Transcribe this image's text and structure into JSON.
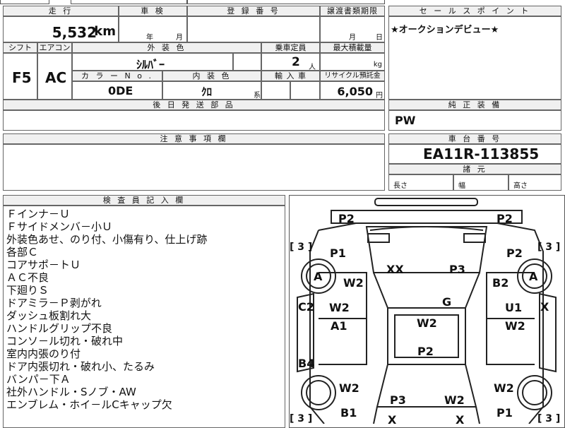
{
  "sheet": {
    "mileage": {
      "header": "走 行",
      "value": "5,532",
      "unit": "km"
    },
    "inspection": {
      "header": "車 検",
      "year": "年",
      "month": "月"
    },
    "registration": {
      "header": "登 録 番 号",
      "value": ""
    },
    "transfer_deadline": {
      "header": "譲渡書類期限",
      "month": "月",
      "day": "日"
    },
    "shift": {
      "header": "シフト",
      "value": "F5"
    },
    "aircon": {
      "header": "エアコン",
      "value": "AC"
    },
    "exterior_color": {
      "header": "外 装 色",
      "value": "ｼﾙﾊﾞｰ"
    },
    "capacity": {
      "header": "乗車定員",
      "value": "2",
      "unit": "人"
    },
    "max_load": {
      "header": "最大積載量",
      "value": "",
      "unit": "kg"
    },
    "color_no": {
      "header": "カ ラ ー N o .",
      "value": "0DE"
    },
    "interior_color": {
      "header": "内 装 色",
      "value": "ｸﾛ",
      "suffix": "系"
    },
    "import": {
      "header": "輸 入 車",
      "value": ""
    },
    "recycle": {
      "header": "リサイクル預託金",
      "value": "6,050",
      "unit": "円"
    },
    "later_parts": {
      "header": "後 日 発 送 部 品",
      "value": ""
    },
    "sales_point": {
      "header": "セ ー ル ス ポ イ ン ト",
      "value": "★オークションデビュー★"
    },
    "equipment": {
      "header": "純 正 装 備",
      "value": "PW"
    },
    "caution": {
      "header": "注 意 事 項 欄",
      "value": ""
    },
    "chassis": {
      "header": "車 台 番 号",
      "value": "EA11R-113855"
    },
    "dimensions": {
      "header": "諸 元",
      "length": "長さ",
      "width": "幅",
      "height": "高さ"
    },
    "inspector_notes": {
      "header": "検 査 員 記 入 欄",
      "lines": [
        "Ｆインナ－Ｕ",
        "Ｆサイドメンバ－小Ｕ",
        "外装色あせ、のり付、小傷有り、仕上げ跡",
        "各部Ｃ",
        "コアサポ－トＵ",
        "ＡＣ不良",
        "下廻りＳ",
        "ドアミラ－Ｐ剥がれ",
        "ダッシュ板割れ大",
        "ハンドルグリップ不良",
        "コンソ－ル切れ・破れ中",
        "室内内張のり付",
        "ドア内張切れ・破れ小、たるみ",
        "バンパ－下Ａ",
        "社外ハンドル・Sノブ・AW",
        "エンブレム・ホイ－ルCキャップ欠"
      ]
    }
  },
  "diagram": {
    "marks": {
      "front_left_bumper": "P2",
      "front_right_bumper": "P2",
      "fender_left": "P1",
      "fender_right": "P2",
      "hood_left": "XX",
      "hood_right": "P3",
      "wheel_fl_label": "A",
      "wheel_fr_label": "A",
      "fl_w2": "W2",
      "fr_b2": "B2",
      "roof_g": "G",
      "door_l_w2": "W2",
      "door_l_a1": "A1",
      "door_r_u1": "U1",
      "door_r_w2": "W2",
      "roof_w2": "W2",
      "pillar_l_c2": "C2",
      "right_x": "X",
      "roof_p2": "P2",
      "sill_l_b4": "B4",
      "rear_l_w2": "W2",
      "rear_r_w2": "W2",
      "trunk_p3": "P3",
      "trunk_w2": "W2",
      "rear_l_b1": "B1",
      "rear_r_p1": "P1",
      "tail_x_left": "X",
      "tail_x_right": "X",
      "tire_fl": "[ 3 ]",
      "tire_fr": "[ 3 ]",
      "tire_rl": "[ 3 ]",
      "tire_rr": "[ 3 ]"
    }
  }
}
